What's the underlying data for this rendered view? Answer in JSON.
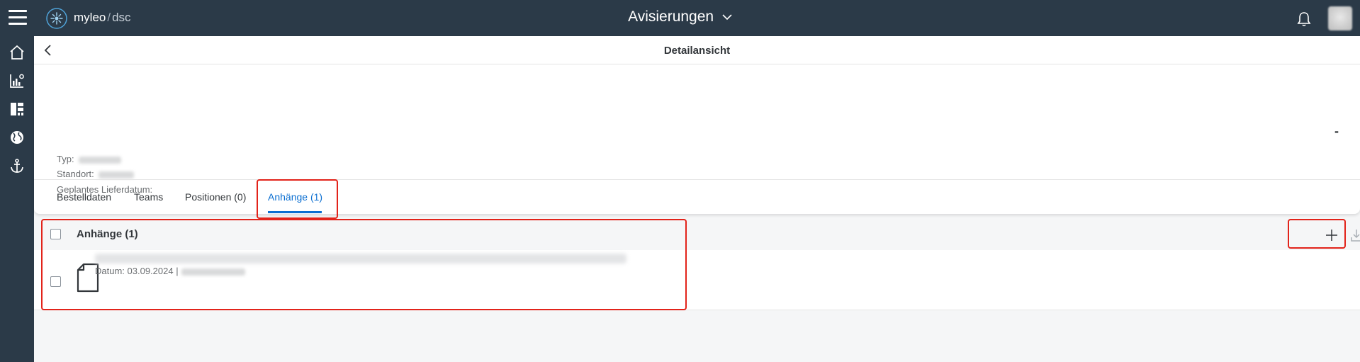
{
  "shell": {
    "brand": "myleo",
    "brand_separator": "/",
    "brand_sub": "dsc",
    "title": "Avisierungen"
  },
  "sidenav": {
    "items": [
      {
        "icon": "home-icon"
      },
      {
        "icon": "chart-settings-icon"
      },
      {
        "icon": "dashboard-icon"
      },
      {
        "icon": "globe-icon"
      },
      {
        "icon": "anchor-icon"
      }
    ]
  },
  "page": {
    "subtitle": "Detailansicht",
    "right_value": "-",
    "attributes": {
      "type_label": "Typ:",
      "location_label": "Standort:",
      "delivery_label": "Geplantes Lieferdatum:"
    },
    "tabs": [
      {
        "label": "Bestelldaten",
        "active": false
      },
      {
        "label": "Teams",
        "active": false
      },
      {
        "label": "Positionen (0)",
        "active": false
      },
      {
        "label": "Anhänge (1)",
        "active": true
      }
    ]
  },
  "attachments": {
    "title": "Anhänge (1)",
    "items": [
      {
        "date_label": "Datum: 03.09.2024 |"
      }
    ]
  },
  "colors": {
    "shell_bg": "#2b3a48",
    "accent": "#0a6ed1",
    "highlight": "#e2231a"
  }
}
